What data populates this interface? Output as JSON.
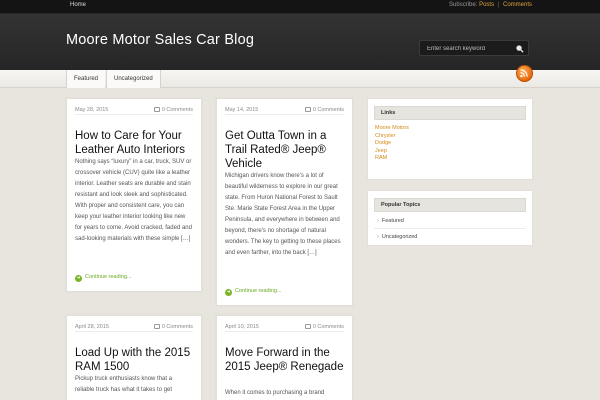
{
  "topbar": {
    "home": "Home",
    "subscribe_label": "Subscribe:",
    "posts": "Posts",
    "separator": "|",
    "comments": "Comments"
  },
  "header": {
    "site_title": "Moore Motor Sales Car Blog",
    "search_placeholder": "Enter search keyword"
  },
  "nav": {
    "tabs": [
      "Featured",
      "Uncategorized"
    ]
  },
  "posts": [
    {
      "date": "May 28, 2015",
      "comments": "0 Comments",
      "title": "How to Care for Your Leather Auto Interiors",
      "excerpt": "Nothing says “luxury” in a car, truck, SUV or crossover vehicle (CUV) quite like a leather interior. Leather seats are durable and stain resistant and look sleek and sophisticated. With proper and consistent care, you can keep your leather interior looking like new for years to come. Avoid cracked, faded and sad-looking materials with these simple […]",
      "continue": "Continue reading..."
    },
    {
      "date": "May 14, 2015",
      "comments": "0 Comments",
      "title": "Get Outta Town in a Trail Rated® Jeep® Vehicle",
      "excerpt": "Michigan drivers know there’s a lot of beautiful wilderness to explore in our great state. From Huron National Forest to Sault Ste. Marie State Forest Area in the Upper Peninsula, and everywhere in between and beyond, there’s no shortage of natural wonders. The key to getting to these places and even farther, into the back […]",
      "continue": "Continue reading..."
    },
    {
      "date": "April 28, 2015",
      "comments": "0 Comments",
      "title": "Load Up with the 2015 RAM 1500",
      "excerpt": "Pickup truck enthusiasts know that a reliable truck has what it takes to get",
      "continue": ""
    },
    {
      "date": "April 10, 2015",
      "comments": "0 Comments",
      "title": "Move Forward in the 2015 Jeep® Renegade",
      "excerpt": "When it comes to purchasing a brand",
      "continue": ""
    }
  ],
  "sidebar": {
    "links_title": "Links",
    "links": [
      "Moore Motors",
      "Chrysler",
      "Dodge",
      "Jeep",
      "RAM"
    ],
    "topics_title": "Popular Topics",
    "topics": [
      "Featured",
      "Uncategorized"
    ]
  },
  "colors": {
    "accent_link": "#d48a1a",
    "continue_green": "#6aa81e",
    "header_dark": "#262626"
  }
}
